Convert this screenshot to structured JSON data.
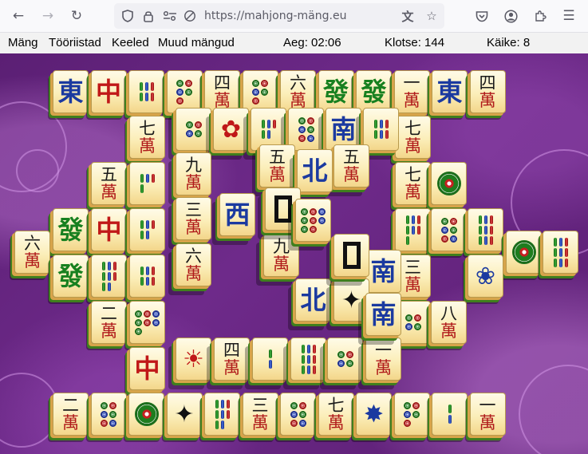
{
  "browser": {
    "url": "https://mahjong-mäng.eu",
    "icons": [
      "back-icon",
      "forward-icon",
      "reload-icon",
      "shield-icon",
      "lock-icon",
      "permissions-icon",
      "tracking-blocked-icon",
      "translate-icon",
      "bookmark-star-icon",
      "pocket-icon",
      "account-icon",
      "extensions-icon",
      "menu-icon"
    ]
  },
  "menu": {
    "items": [
      "Mäng",
      "Tööriistad",
      "Keeled",
      "Muud mängud"
    ],
    "time_label": "Aeg: 02:06",
    "tiles_label": "Klotse: 144",
    "moves_label": "Käike: 8"
  },
  "colors": {
    "board_bg": "#6a2886",
    "tile_face": "#fbeeb9",
    "tile_edge_green": "#3f7f1d",
    "char_red": "#c01818",
    "dragon_green": "#17801f",
    "wind_blue": "#1b3aa0"
  },
  "tiles": {
    "row1": [
      "東",
      "中",
      "bamboo-6",
      "circles-5",
      "四萬",
      "circles-5",
      "六萬",
      "發",
      "發",
      "一萬",
      "東",
      "四萬"
    ],
    "inner_top": [
      "circles-4",
      "hibiscus",
      "bamboo-5",
      "circles-6",
      "南",
      "bamboo-6",
      "七萬"
    ],
    "left_block": [
      "七萬",
      "五萬",
      "bamboo-4",
      "九萬",
      "三萬",
      "六萬",
      "發",
      "中",
      "bamboo-5",
      "發",
      "bamboo-8",
      "bamboo-6",
      "二萬",
      "circles-7",
      "六萬"
    ],
    "center": [
      "五萬",
      "北",
      "五萬",
      "西",
      "白",
      "circles-8",
      "白",
      "九萬",
      "南",
      "北",
      "bird",
      "南"
    ],
    "right_block": [
      "七萬",
      "bamboo-7",
      "circles-1",
      "三萬",
      "circles-6",
      "bamboo-9",
      "circles-1",
      "bamboo-9",
      "plum-flower",
      "circles-4",
      "八萬"
    ],
    "bottom": [
      "中",
      "sun",
      "四萬",
      "bamboo-2",
      "bamboo-9",
      "circles-4",
      "一萬",
      "二萬",
      "circles-6",
      "circles-1",
      "bird",
      "bamboo-8",
      "三萬",
      "circles-6",
      "七萬",
      "chrysanthemum",
      "circles-5",
      "bamboo-2",
      "一萬"
    ]
  }
}
